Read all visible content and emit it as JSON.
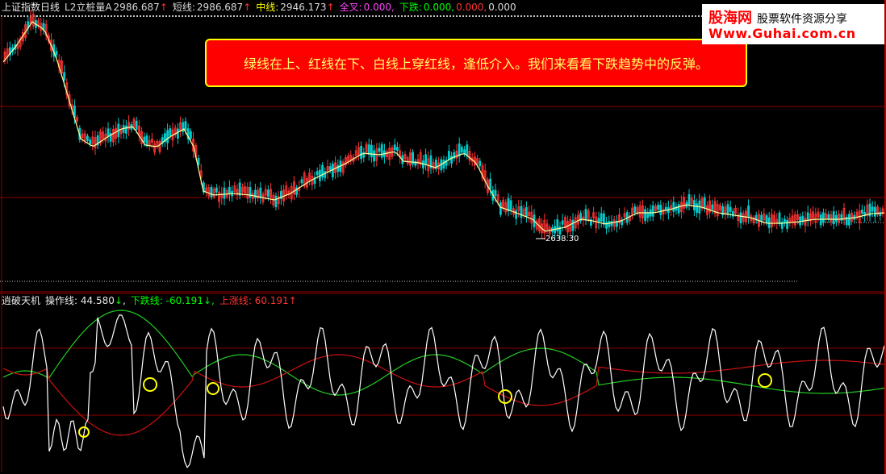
{
  "header": {
    "title": "上证指数日线",
    "items": [
      {
        "label": "L2立桩量A",
        "value": "2986.687"
      },
      {
        "label": "短线:",
        "value": "2986.687"
      },
      {
        "label": "中线:",
        "value": "2946.173"
      },
      {
        "label": "全叉:",
        "value": "0.000,"
      },
      {
        "label": "下跌:",
        "value": "0.000,",
        "value2": "0.000,",
        "value3": "0.000"
      }
    ]
  },
  "banner": {
    "text": "绿线在上、红线在下、白线上穿红线，逢低介入。我们来看看下跌趋势中的反弹。"
  },
  "watermark": {
    "brand": "股海网",
    "tagline": "股票软件资源分享",
    "url": "Www.Guhai.com.cn"
  },
  "chart": {
    "low_label": "2638.30"
  },
  "indicator": {
    "name": "逍破天机",
    "items": [
      {
        "label": "操作线: ",
        "value": "44.580"
      },
      {
        "label": "下跌线: ",
        "value": "-60.191"
      },
      {
        "label": "上涨线: ",
        "value": "60.191"
      }
    ]
  },
  "colors": {
    "background": "#000000",
    "banner_bg": "#ff0000",
    "banner_text": "#ffff66",
    "up_candle": "#ff3333",
    "down_candle": "#00cccc",
    "downtrend_line": "#22cc22",
    "uptrend_line": "#cc1111",
    "operation_line": "#ffffff",
    "signal_circle": "#ffff00"
  }
}
